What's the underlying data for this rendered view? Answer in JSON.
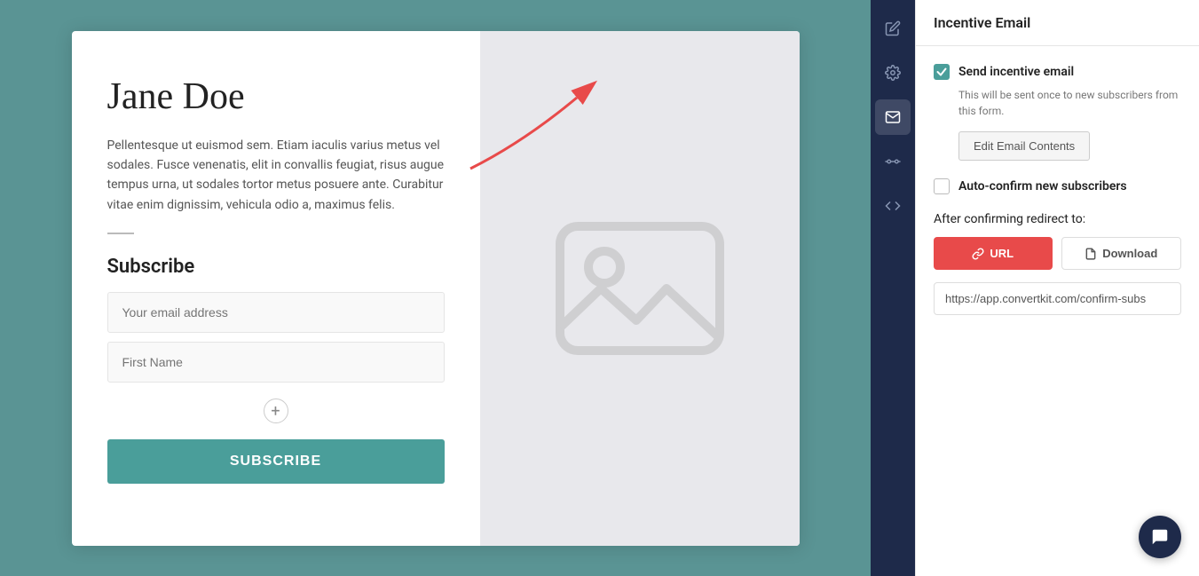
{
  "panel": {
    "title": "Incentive Email",
    "send_incentive": {
      "label": "Send incentive email",
      "checked": true,
      "helper": "This will be sent once to new subscribers from this form.",
      "edit_btn": "Edit Email Contents"
    },
    "auto_confirm": {
      "label": "Auto-confirm new subscribers",
      "checked": false
    },
    "redirect": {
      "section_label": "After confirming redirect to:",
      "url_btn": "URL",
      "download_btn": "Download",
      "url_value": "https://app.convertkit.com/confirm-subs"
    }
  },
  "form": {
    "title": "Jane Doe",
    "description": "Pellentesque ut euismod sem. Etiam iaculis varius metus vel sodales. Fusce venenatis, elit in convallis feugiat, risus augue tempus urna, ut sodales tortor metus posuere ante. Curabitur vitae enim dignissim, vehicula odio a, maximus felis.",
    "subscribe_label": "Subscribe",
    "email_placeholder": "Your email address",
    "name_placeholder": "First Name",
    "submit_label": "SUBSCRIBE"
  },
  "sidebar": {
    "icons": [
      {
        "name": "edit-icon",
        "symbol": "✏",
        "active": false
      },
      {
        "name": "settings-icon",
        "symbol": "⚙",
        "active": false
      },
      {
        "name": "email-icon",
        "symbol": "✉",
        "active": true
      },
      {
        "name": "advanced-settings-icon",
        "symbol": "⚙",
        "active": false
      },
      {
        "name": "code-icon",
        "symbol": "</>",
        "active": false
      }
    ]
  },
  "chat": {
    "icon": "💬"
  }
}
